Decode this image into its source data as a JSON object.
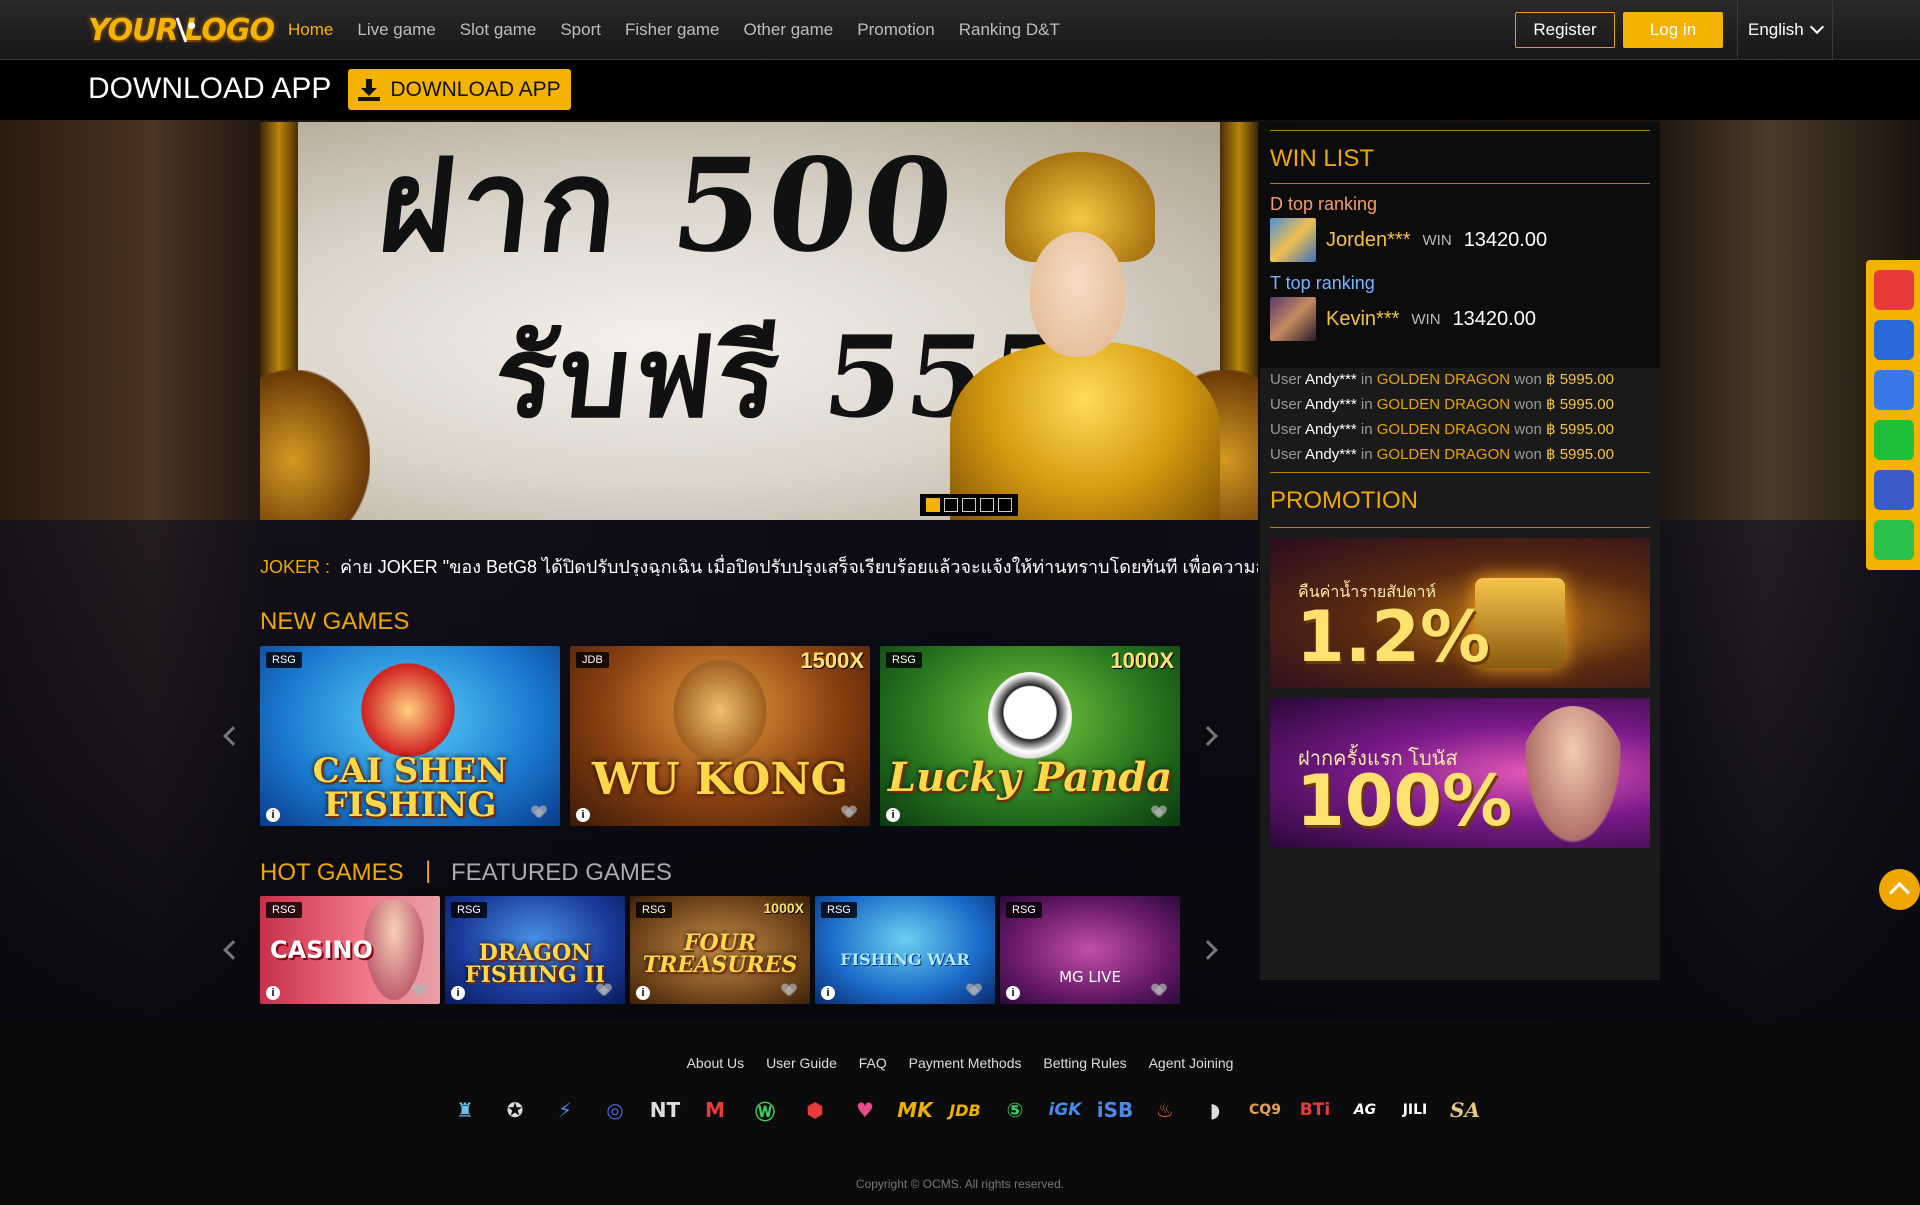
{
  "header": {
    "logo_text": "YOUR LOGO",
    "nav": [
      "Home",
      "Live game",
      "Slot game",
      "Sport",
      "Fisher game",
      "Other game",
      "Promotion",
      "Ranking D&T"
    ],
    "register": "Register",
    "login": "Log in",
    "language": "English"
  },
  "download": {
    "title": "DOWNLOAD APP",
    "button": "DOWNLOAD APP"
  },
  "banner": {
    "line1": "ฝาก 500",
    "line2": "รับฟรี 555",
    "slides": 5,
    "active_slide": 1
  },
  "win_list": {
    "title": "WIN LIST",
    "d_title": "D top ranking",
    "d_name": "Jorden***",
    "d_win": "WIN",
    "d_amount": "13420.00",
    "t_title": "T top ranking",
    "t_name": "Kevin***",
    "t_win": "WIN",
    "t_amount": "13420.00",
    "feed": [
      {
        "user_label": "User",
        "name": "Andy***",
        "in": "in",
        "game": "GOLDEN DRAGON",
        "won": "won",
        "money": "฿ 5995.00"
      },
      {
        "user_label": "User",
        "name": "Andy***",
        "in": "in",
        "game": "GOLDEN DRAGON",
        "won": "won",
        "money": "฿ 5995.00"
      },
      {
        "user_label": "User",
        "name": "Andy***",
        "in": "in",
        "game": "GOLDEN DRAGON",
        "won": "won",
        "money": "฿ 5995.00"
      },
      {
        "user_label": "User",
        "name": "Andy***",
        "in": "in",
        "game": "GOLDEN DRAGON",
        "won": "won",
        "money": "฿ 5995.00"
      }
    ]
  },
  "promotion": {
    "title": "PROMOTION",
    "promo1_small": "คืนค่าน้ำรายสัปดาห์",
    "promo1_big": "1.2%",
    "promo2_small": "ฝากครั้งแรก โบนัส",
    "promo2_big": "100%"
  },
  "ticker": {
    "label": "JOKER :",
    "text": "ค่าย JOKER \"ของ BetG8 ได้ปิดปรับปรุงฉุกเฉิน เมื่อปิดปรับปรุงเสร็จเรียบร้อยแล้วจะแจ้งให้ท่านทราบโดยทันที เพื่อความสะดวก"
  },
  "new_games": {
    "title": "NEW GAMES",
    "cards": [
      {
        "tag": "RSG",
        "title": "CAI SHEN FISHING",
        "mult": ""
      },
      {
        "tag": "JDB",
        "title": "WU KONG",
        "mult": "1500X"
      },
      {
        "tag": "RSG",
        "title": "Lucky Panda",
        "mult": "1000X"
      }
    ]
  },
  "hot_games": {
    "title": "HOT GAMES",
    "divider": "|",
    "featured_title": "FEATURED GAMES",
    "cards": [
      {
        "tag": "RSG",
        "title": "CASINO",
        "mult": ""
      },
      {
        "tag": "RSG",
        "title": "DRAGON FISHING II",
        "mult": ""
      },
      {
        "tag": "RSG",
        "title": "FOUR TREASURES",
        "mult": "1000X"
      },
      {
        "tag": "RSG",
        "title": "FISHING WAR",
        "mult": ""
      },
      {
        "tag": "RSG",
        "title": "MG LIVE",
        "mult": ""
      }
    ]
  },
  "footer": {
    "links": [
      "About Us",
      "User Guide",
      "FAQ",
      "Payment Methods",
      "Betting Rules",
      "Agent Joining"
    ],
    "providers": [
      "",
      "",
      "",
      "",
      "NT",
      "M",
      "",
      "",
      "",
      "MK",
      "JDB",
      "",
      "iGK",
      "iSB",
      "",
      "",
      "CQ9",
      "BTi",
      "AG",
      "JILI",
      "SA"
    ],
    "copyright": "Copyright © OCMS. All rights reserved."
  }
}
